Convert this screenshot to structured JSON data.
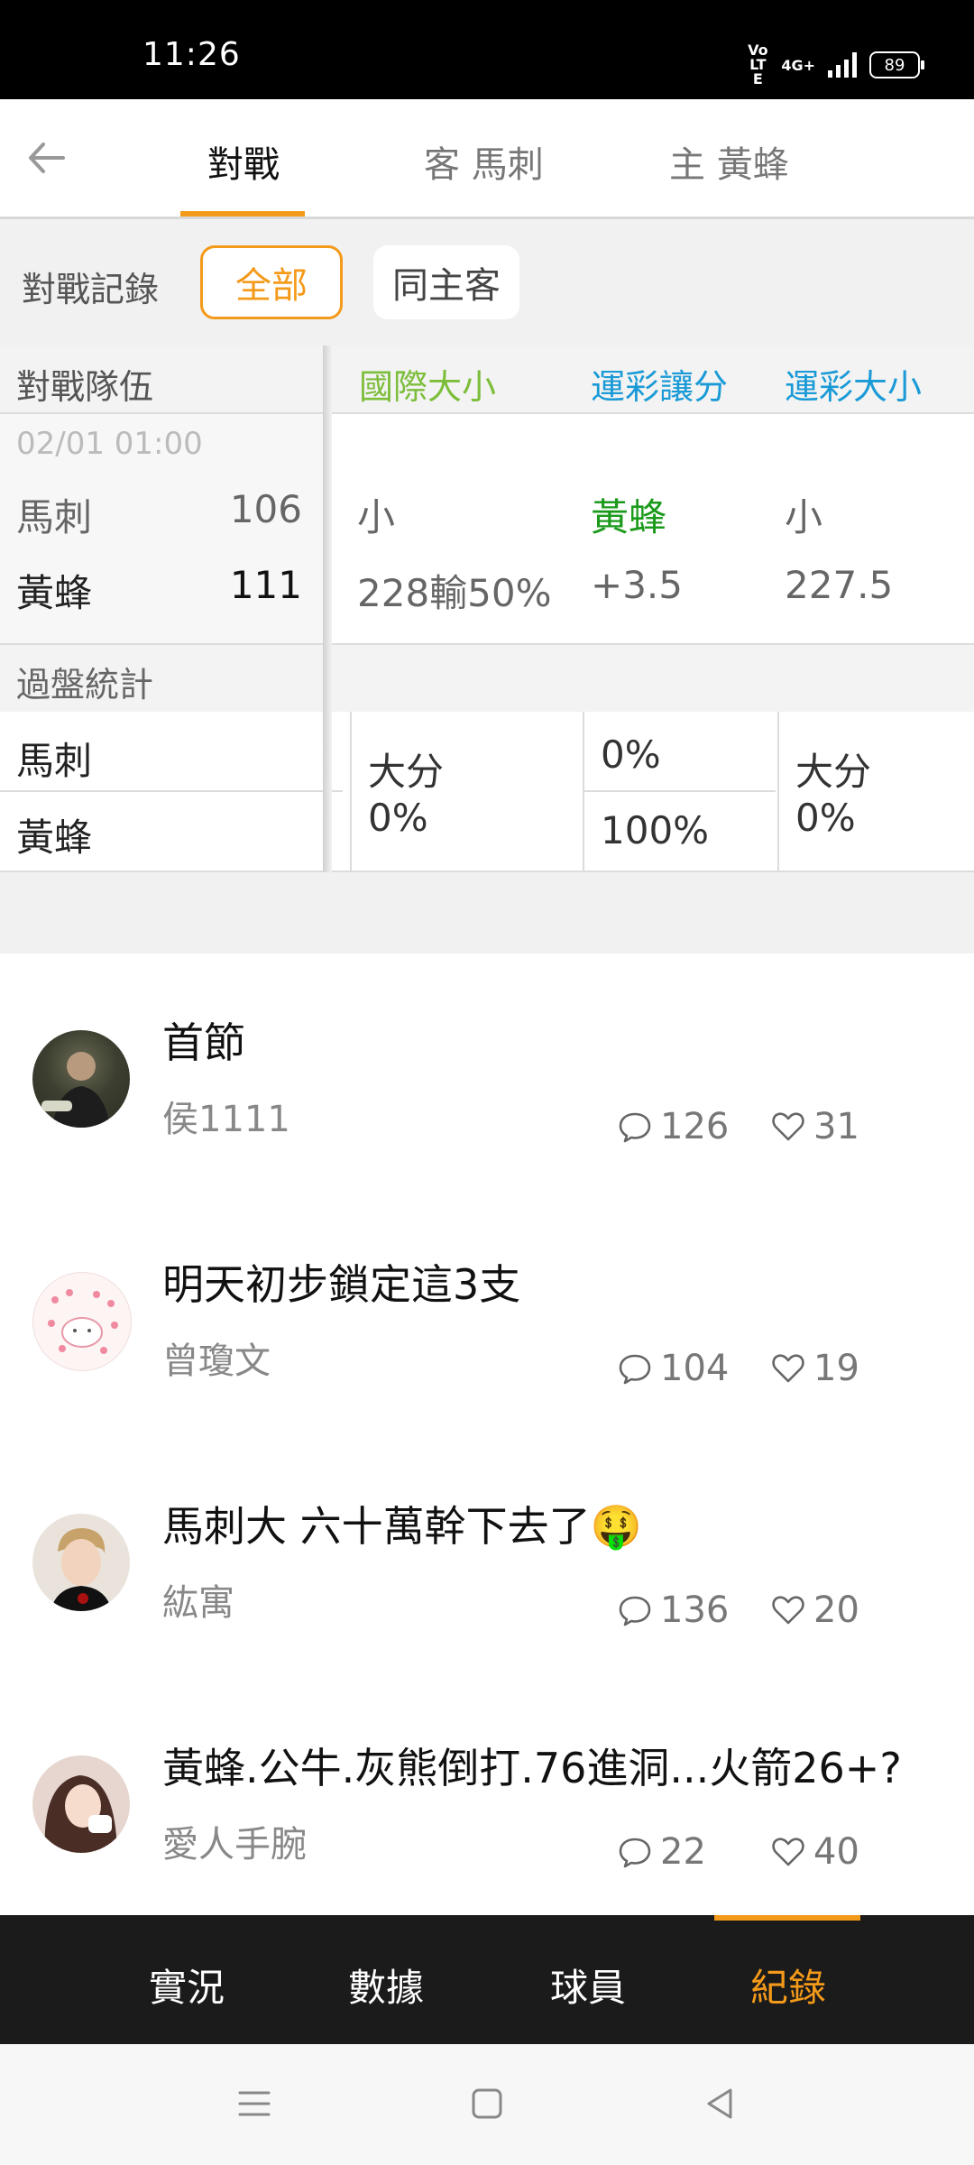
{
  "status": {
    "time": "11:26",
    "battery": "89",
    "network": "4G+",
    "volte": "Vo LTE"
  },
  "nav": {
    "tabs": [
      {
        "label": "對戰"
      },
      {
        "label": "客 馬刺"
      },
      {
        "label": "主 黃蜂"
      }
    ]
  },
  "filter": {
    "label": "對戰記錄",
    "options": [
      "全部",
      "同主客"
    ],
    "selected": "全部"
  },
  "table": {
    "headers": {
      "team": "對戰隊伍",
      "col1": "國際大小",
      "col2": "運彩讓分",
      "col3": "運彩大小"
    },
    "game": {
      "date": "02/01 01:00",
      "away": {
        "name": "馬刺",
        "score": "106"
      },
      "home": {
        "name": "黃蜂",
        "score": "111"
      },
      "col1": [
        "小",
        "228輸50%"
      ],
      "col2": [
        "黃蜂",
        "+3.5"
      ],
      "col3": [
        "小",
        "227.5"
      ]
    },
    "stats": {
      "label": "過盤統計",
      "teams": [
        "馬刺",
        "黃蜂"
      ],
      "col1": [
        "大分",
        "0%"
      ],
      "col2": [
        "0%",
        "100%"
      ],
      "col3": [
        "大分",
        "0%"
      ]
    }
  },
  "posts": [
    {
      "title": "首節",
      "author": "侯1111",
      "comments": "126",
      "likes": "31"
    },
    {
      "title": "明天初步鎖定這3支",
      "author": "曾瓊文",
      "comments": "104",
      "likes": "19"
    },
    {
      "title": "馬刺大 六十萬幹下去了🤑",
      "author": "紘寓",
      "comments": "136",
      "likes": "20"
    },
    {
      "title": "黃蜂.公牛.灰熊倒打.76進洞...火箭26+?",
      "author": "愛人手腕",
      "comments": "22",
      "likes": "40"
    }
  ],
  "bottom_tabs": [
    {
      "label": "實況"
    },
    {
      "label": "數據"
    },
    {
      "label": "球員"
    },
    {
      "label": "紀錄"
    }
  ],
  "colors": {
    "accent": "#f49a1a",
    "green_header": "#7cbd3a",
    "blue_header": "#1a9ad6",
    "team_green": "#1a9a1a"
  }
}
